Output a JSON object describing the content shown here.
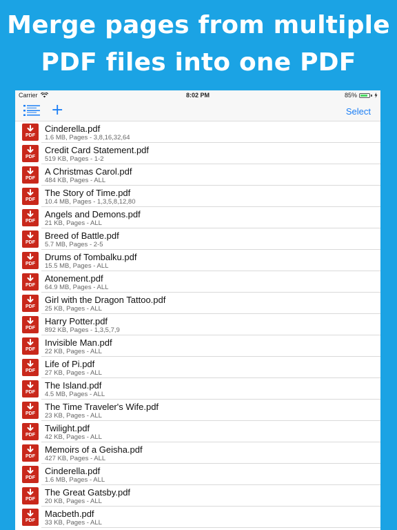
{
  "headline": {
    "line1": "Merge pages from multiple",
    "line2": "PDF files into one PDF"
  },
  "status_bar": {
    "carrier": "Carrier",
    "time": "8:02 PM",
    "battery": "85%",
    "battery_level": 0.85
  },
  "toolbar": {
    "plus_label": "+",
    "select_label": "Select",
    "accent_color": "#1a7ef5"
  },
  "pdf_icon_label": "PDF",
  "files": [
    {
      "name": "Cinderella.pdf",
      "meta": "1.6 MB, Pages - 3,8,16,32,64"
    },
    {
      "name": "Credit Card Statement.pdf",
      "meta": "519 KB, Pages - 1-2"
    },
    {
      "name": "A Christmas Carol.pdf",
      "meta": "484 KB, Pages - ALL"
    },
    {
      "name": "The Story of Time.pdf",
      "meta": "10.4 MB, Pages - 1,3,5,8,12,80"
    },
    {
      "name": "Angels and Demons.pdf",
      "meta": "21 KB, Pages - ALL"
    },
    {
      "name": "Breed of Battle.pdf",
      "meta": "5.7 MB, Pages - 2-5"
    },
    {
      "name": "Drums of Tombalku.pdf",
      "meta": "15.5 MB, Pages - ALL"
    },
    {
      "name": "Atonement.pdf",
      "meta": "64.9 MB, Pages - ALL"
    },
    {
      "name": "Girl with the Dragon Tattoo.pdf",
      "meta": "25 KB, Pages - ALL"
    },
    {
      "name": "Harry Potter.pdf",
      "meta": "892 KB, Pages - 1,3,5,7,9"
    },
    {
      "name": "Invisible Man.pdf",
      "meta": "22 KB, Pages - ALL"
    },
    {
      "name": "Life of Pi.pdf",
      "meta": "27 KB, Pages - ALL"
    },
    {
      "name": "The Island.pdf",
      "meta": "4.5 MB, Pages - ALL"
    },
    {
      "name": "The Time Traveler's Wife.pdf",
      "meta": "23 KB, Pages - ALL"
    },
    {
      "name": "Twilight.pdf",
      "meta": "42 KB, Pages - ALL"
    },
    {
      "name": "Memoirs of a Geisha.pdf",
      "meta": "427 KB, Pages - ALL"
    },
    {
      "name": "Cinderella.pdf",
      "meta": "1.6 MB, Pages - ALL"
    },
    {
      "name": "The Great Gatsby.pdf",
      "meta": "20 KB, Pages - ALL"
    },
    {
      "name": "Macbeth.pdf",
      "meta": "33 KB, Pages - ALL"
    }
  ]
}
